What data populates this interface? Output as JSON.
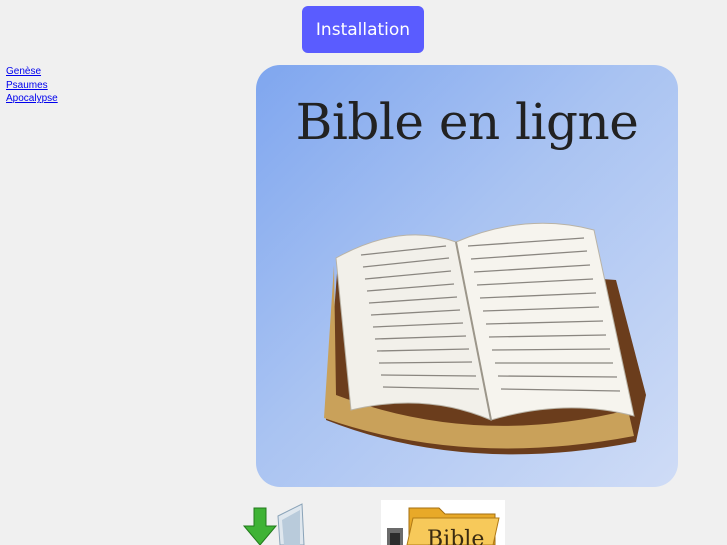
{
  "header": {
    "install_label": "Installation"
  },
  "nav": {
    "links": [
      "Genèse",
      "Psaumes",
      "Apocalypse"
    ]
  },
  "hero": {
    "title": "Bible en ligne"
  },
  "bottom_icons": {
    "folder_label": "Bible"
  },
  "colors": {
    "button": "#5a5cff",
    "link": "#0000ee",
    "background": "#f0f0f0"
  }
}
